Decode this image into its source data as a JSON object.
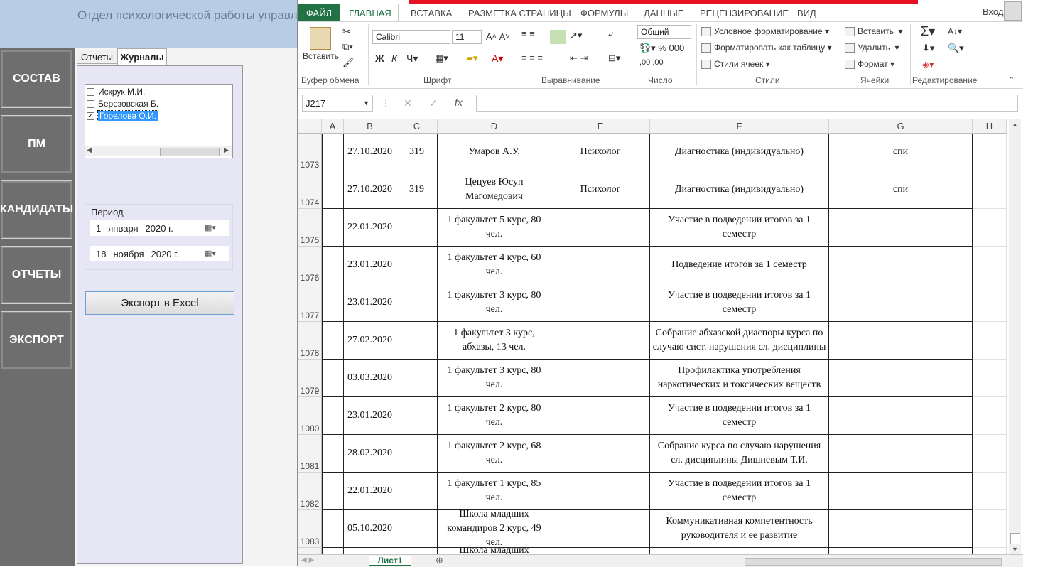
{
  "app": {
    "title": "Отдел психологической работы управле",
    "nav": [
      "СОСТАВ",
      "ПМ",
      "КАНДИДАТЫ",
      "ОТЧЕТЫ",
      "ЭКСПОРТ"
    ],
    "tabs": [
      "Отчеты",
      "Журналы"
    ],
    "journal_list": [
      {
        "label": "Искрук М.И.",
        "checked": false
      },
      {
        "label": "Березовская Б.",
        "checked": false
      },
      {
        "label": "Горелова О.И.",
        "checked": true
      }
    ],
    "period": {
      "label": "Период",
      "from": {
        "day": "1",
        "month": "января",
        "year": "2020 г."
      },
      "to": {
        "day": "18",
        "month": "ноября",
        "year": "2020 г."
      }
    },
    "export_button": "Экспорт в  Excel"
  },
  "excel": {
    "ribbon_tabs": [
      "ФАЙЛ",
      "ГЛАВНАЯ",
      "ВСТАВКА",
      "РАЗМЕТКА СТРАНИЦЫ",
      "ФОРМУЛЫ",
      "ДАННЫЕ",
      "РЕЦЕНЗИРОВАНИЕ",
      "ВИД"
    ],
    "signin": "Вход",
    "groups": [
      "Буфер обмена",
      "Шрифт",
      "Выравнивание",
      "Число",
      "Стили",
      "Ячейки",
      "Редактирование"
    ],
    "paste_label": "Вставить",
    "font_name": "Calibri",
    "font_size": "11",
    "number_format": "Общий",
    "styles": [
      "Условное форматирование",
      "Форматировать как таблицу",
      "Стили ячеек"
    ],
    "cells": [
      "Вставить",
      "Удалить",
      "Формат"
    ],
    "name_box": "J217",
    "columns": [
      "A",
      "B",
      "C",
      "D",
      "E",
      "F",
      "G",
      "H"
    ],
    "rows": [
      {
        "n": "1073",
        "b": "27.10.2020",
        "c": "319",
        "d": "Умаров А.У.",
        "e": "Психолог",
        "f": "Диагностика (индивидуально)",
        "g": "спи"
      },
      {
        "n": "1074",
        "b": "27.10.2020",
        "c": "319",
        "d": "Цецуев Юсуп Магомедович",
        "e": "Психолог",
        "f": "Диагностика (индивидуально)",
        "g": "спи"
      },
      {
        "n": "1075",
        "b": "22.01.2020",
        "c": "",
        "d": "1 факультет 5 курс, 80 чел.",
        "e": "",
        "f": "Участие в подведении итогов за 1 семестр",
        "g": ""
      },
      {
        "n": "1076",
        "b": "23.01.2020",
        "c": "",
        "d": "1 факультет 4 курс, 60 чел.",
        "e": "",
        "f": "Подведение итогов за 1 семестр",
        "g": ""
      },
      {
        "n": "1077",
        "b": "23.01.2020",
        "c": "",
        "d": "1 факультет 3 курс, 80 чел.",
        "e": "",
        "f": "Участие в подведении итогов за 1 семестр",
        "g": ""
      },
      {
        "n": "1078",
        "b": "27.02.2020",
        "c": "",
        "d": "1 факультет 3 курс, абхазы, 13 чел.",
        "e": "",
        "f": "Собрание абхазской диаспоры курса по случаю сист. нарушения сл. дисциплины",
        "g": ""
      },
      {
        "n": "1079",
        "b": "03.03.2020",
        "c": "",
        "d": "1 факультет 3 курс, 80 чел.",
        "e": "",
        "f": "Профилактика употребления наркотических и токсических веществ",
        "g": ""
      },
      {
        "n": "1080",
        "b": "23.01.2020",
        "c": "",
        "d": "1 факультет 2 курс, 80 чел.",
        "e": "",
        "f": "Участие в подведении итогов за 1 семестр",
        "g": ""
      },
      {
        "n": "1081",
        "b": "28.02.2020",
        "c": "",
        "d": "1 факультет 2 курс, 68 чел.",
        "e": "",
        "f": "Собрание курса по случаю нарушения сл. дисциплины Дишневым Т.И.",
        "g": ""
      },
      {
        "n": "1082",
        "b": "22.01.2020",
        "c": "",
        "d": "1 факультет 1 курс, 85 чел.",
        "e": "",
        "f": "Участие в подведении итогов за 1 семестр",
        "g": ""
      },
      {
        "n": "1083",
        "b": "05.10.2020",
        "c": "",
        "d": "Школа младших командиров 2 курс, 49 чел.",
        "e": "",
        "f": "Коммуникативная компетентность руководителя и ее развитие",
        "g": ""
      },
      {
        "n": "",
        "b": "",
        "c": "",
        "d": "Школа младших",
        "e": "",
        "f": "",
        "g": ""
      }
    ],
    "sheet_tab": "Лист1"
  }
}
